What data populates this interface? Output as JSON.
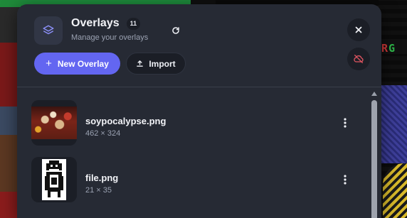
{
  "header": {
    "title": "Overlays",
    "count": "11",
    "subtitle": "Manage your overlays",
    "icon": "layers-icon"
  },
  "actions": {
    "new_overlay_label": "New Overlay",
    "import_label": "Import"
  },
  "colors": {
    "accent": "#6366f1",
    "panel_bg": "#262a34",
    "hide_icon": "#e05561"
  },
  "overlays": [
    {
      "name": "soypocalypse.png",
      "dims": "462 × 324"
    },
    {
      "name": "file.png",
      "dims": "21 × 35"
    }
  ],
  "backdrop": {
    "partial_text": "RG"
  }
}
